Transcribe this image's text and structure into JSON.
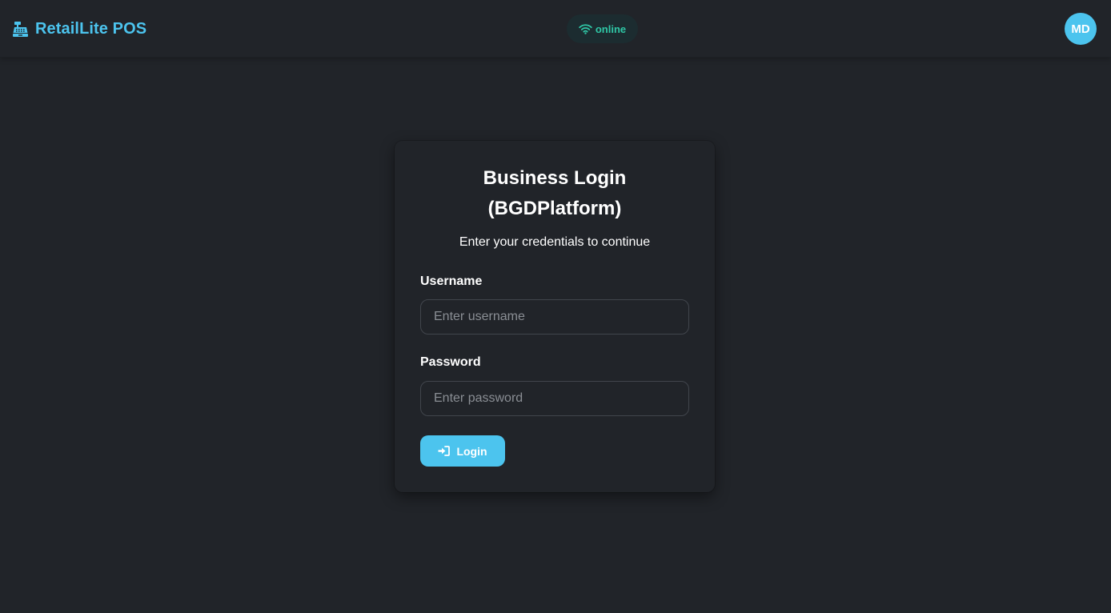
{
  "header": {
    "brand": {
      "name": "RetailLite POS",
      "icon": "cash-register-icon",
      "color": "#4cc4ee"
    },
    "status": {
      "icon": "wifi-icon",
      "label": "online",
      "color": "#2fc7a6"
    },
    "avatar": {
      "initials": "MD",
      "color": "#4cc4ee"
    }
  },
  "login": {
    "title_line1": "Business Login",
    "title_line2": "(BGDPlatform)",
    "subtitle": "Enter your credentials to continue",
    "username": {
      "label": "Username",
      "value": "",
      "placeholder": "Enter username"
    },
    "password": {
      "label": "Password",
      "value": "",
      "placeholder": "Enter password"
    },
    "submit": {
      "icon": "sign-in-icon",
      "label": "Login",
      "color": "#4cc4ee"
    }
  },
  "theme": {
    "background": "#212429",
    "accent": "#4cc4ee"
  }
}
